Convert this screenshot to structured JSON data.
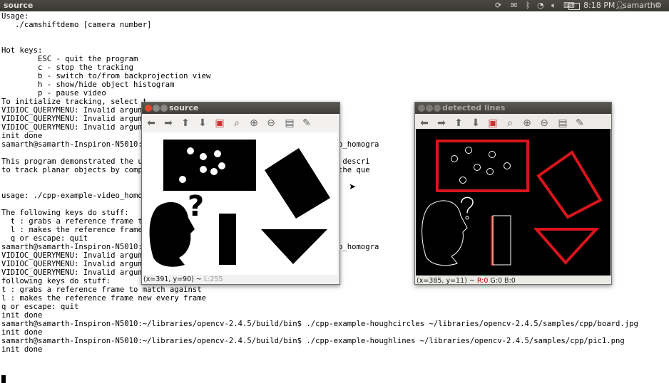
{
  "topbar": {
    "title": "source",
    "time": "8:18 PM",
    "user": "samarth",
    "icons": [
      "sync-icon",
      "mail-icon",
      "bluetooth-icon",
      "wifi-icon",
      "volume-icon",
      "keyboard-icon",
      "battery-icon",
      "user-icon",
      "power-icon"
    ]
  },
  "terminal": {
    "lines": [
      "Usage:",
      "   ./camshiftdemo [camera number]",
      "",
      "",
      "Hot keys:",
      "        ESC - quit the program",
      "        c - stop the tracking",
      "        b - switch to/from backprojection view",
      "        h - show/hide object histogram",
      "        p - pause video",
      "To initialize tracking, select t",
      "VIDIOC_QUERYMENU: Invalid argume",
      "VIDIOC_QUERYMENU: Invalid argume",
      "VIDIOC_QUERYMENU: Invalid argume",
      "init done",
      "samarth@samarth-Inspiron-N5010:~                                  ple-video_homogra",
      "",
      "This program demonstrated the us                                 and brief descri",
      "to track planar objects by compu                                 image to the que",
      "",
      "",
      "usage: ./cpp-example-video_homog",
      "",
      "The following keys do stuff:",
      "  t : grabs a reference frame to",
      "  l : makes the reference frame",
      "  q or escape: quit",
      "samarth@samarth-Inspiron-N5010:~                                  ple-video_homogra",
      "VIDIOC_QUERYMENU: Invalid argume",
      "VIDIOC_QUERYMENU: Invalid argume",
      "VIDIOC_QUERYMENU: Invalid argume",
      "following keys do stuff:",
      "t : grabs a reference frame to match against",
      "l : makes the reference frame new every frame",
      "q or escape: quit",
      "init done",
      "samarth@samarth-Inspiron-N5010:~/libraries/opencv-2.4.5/build/bin$ ./cpp-example-houghcircles ~/libraries/opencv-2.4.5/samples/cpp/board.jpg",
      "init done",
      "samarth@samarth-Inspiron-N5010:~/libraries/opencv-2.4.5/build/bin$ ./cpp-example-houghlines ~/libraries/opencv-2.4.5/samples/cpp/pic1.png",
      "init done"
    ]
  },
  "source_window": {
    "title": "source",
    "status": "(x=391, y=90) ~ ",
    "status_value": "L:255"
  },
  "detected_window": {
    "title": "detected lines",
    "status": "(x=385, y=11) ~ ",
    "status_r": "R:0",
    "status_gb": " G:0 B:0"
  },
  "toolbar_icons": [
    "arrow-left-icon",
    "arrow-right-icon",
    "arrow-up-icon",
    "arrow-down-icon",
    "image-icon",
    "zoom-fit-icon",
    "zoom-in-icon",
    "zoom-out-icon",
    "save-icon",
    "properties-icon"
  ],
  "colors": {
    "red_lines": "#d9141c",
    "panel": "#3c3b37",
    "close_button": "#e0492c"
  }
}
